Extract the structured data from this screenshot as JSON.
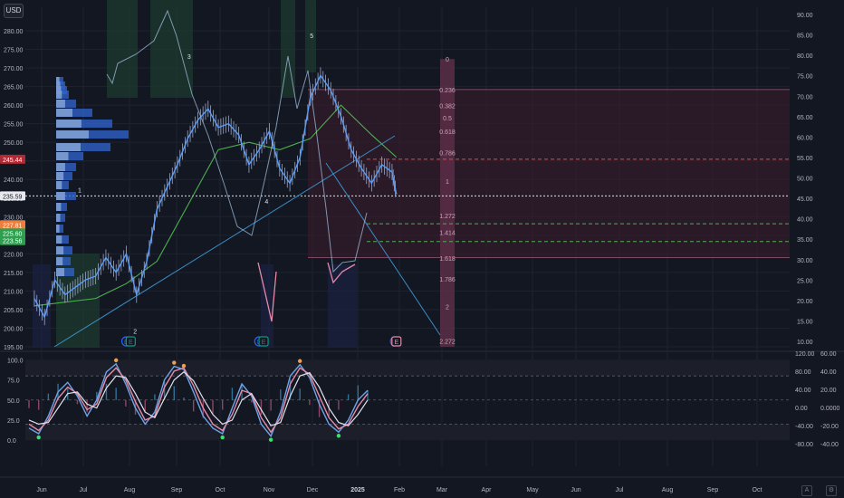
{
  "header": {
    "currency": "USD"
  },
  "colors": {
    "background": "#131722",
    "grid": "#1f2330",
    "price_main": "#5b9cf6",
    "price_alt": "#b5c3e8",
    "ma": "#4caf50",
    "fib_zone": "#3a1d2c",
    "support": "#4caf50",
    "resistance": "#e04a4a",
    "osc_blue": "#6ca4e8",
    "osc_pink": "#e68aa8",
    "osc_white": "#e0e3eb",
    "dot_green": "#39e06d",
    "dot_orange": "#f0a04b"
  },
  "chart_data": [
    {
      "type": "line",
      "panel": "price",
      "x_axis_labels": [
        "Jun",
        "Jul",
        "Aug",
        "Sep",
        "Oct",
        "Nov",
        "Dec",
        "2025",
        "Feb",
        "Mar",
        "Apr",
        "May",
        "Jun",
        "Jul",
        "Aug",
        "Sep",
        "Oct"
      ],
      "left_ticks": [
        "280.00",
        "275.00",
        "270.00",
        "265.00",
        "260.00",
        "255.00",
        "250.00",
        "245.00",
        "240.00",
        "235.00",
        "230.00",
        "225.00",
        "220.00",
        "215.00",
        "210.00",
        "205.00",
        "200.00",
        "195.00"
      ],
      "right_ticks": [
        "90.00",
        "85.00",
        "80.00",
        "75.00",
        "70.00",
        "65.00",
        "60.00",
        "55.00",
        "50.00",
        "45.00",
        "40.00",
        "35.00",
        "30.00",
        "25.00",
        "20.00",
        "15.00",
        "10.00"
      ],
      "ylim_left": [
        195,
        280
      ],
      "price_labels": [
        {
          "text": "245.44",
          "value": 245.44,
          "color": "#b22833"
        },
        {
          "text": "235.59",
          "value": 235.59,
          "color": "#e7e9ef"
        },
        {
          "text": "227.81",
          "value": 227.81,
          "color": "#f07d3a"
        },
        {
          "text": "225.60",
          "value": 225.6,
          "color": "#2e9e4f"
        },
        {
          "text": "223.56",
          "value": 223.56,
          "color": "#2e9e4f"
        }
      ],
      "current_price": 235.59,
      "wave_labels": [
        {
          "text": "1",
          "x": "2024-06-27",
          "price": 236.5
        },
        {
          "text": "2",
          "x": "2024-08-04",
          "price": 198.5
        },
        {
          "text": "3",
          "x": "2024-09-10",
          "price": 272.5
        },
        {
          "text": "4",
          "x": "2024-11-02",
          "price": 233.5
        },
        {
          "text": "5",
          "x": "2024-12-03",
          "price": 278.0
        }
      ],
      "fib_levels": [
        {
          "label": "0",
          "price": 272.4
        },
        {
          "label": "0.236",
          "price": 264.2
        },
        {
          "label": "0.382",
          "price": 259.9
        },
        {
          "label": "0.5",
          "price": 256.6
        },
        {
          "label": "0.618",
          "price": 253.0
        },
        {
          "label": "0.786",
          "price": 247.2
        },
        {
          "label": "1",
          "price": 239.6
        },
        {
          "label": "1.272",
          "price": 230.3
        },
        {
          "label": "1.414",
          "price": 225.8
        },
        {
          "label": "1.618",
          "price": 218.9
        },
        {
          "label": "1.786",
          "price": 213.3
        },
        {
          "label": "2",
          "price": 205.8
        },
        {
          "label": "2.272",
          "price": 196.6
        }
      ],
      "event_markers": [
        {
          "label": "D",
          "x": "2024-07-29",
          "color": "#2962ff"
        },
        {
          "label": "E",
          "x": "2024-08-01",
          "color": "#089981"
        },
        {
          "label": "D",
          "x": "2024-10-28",
          "color": "#2962ff"
        },
        {
          "label": "E",
          "x": "2024-10-31",
          "color": "#089981"
        },
        {
          "label": "D",
          "x": "2025-01-29",
          "color": "#2962ff"
        },
        {
          "label": "E",
          "x": "2025-01-30",
          "color": "#e68aa8"
        }
      ],
      "series": [
        {
          "name": "",
          "points": [
            [
              "2024-05-27",
              208
            ],
            [
              "2024-06-03",
              203
            ],
            [
              "2024-06-10",
              213
            ],
            [
              "2024-06-17",
              209
            ],
            [
              "2024-06-24",
              211
            ],
            [
              "2024-07-01",
              213
            ],
            [
              "2024-07-08",
              214
            ],
            [
              "2024-07-15",
              219
            ],
            [
              "2024-07-22",
              215
            ],
            [
              "2024-07-29",
              220
            ],
            [
              "2024-08-05",
              209
            ],
            [
              "2024-08-12",
              218
            ],
            [
              "2024-08-19",
              232
            ],
            [
              "2024-08-26",
              238
            ],
            [
              "2024-09-02",
              244
            ],
            [
              "2024-09-09",
              251
            ],
            [
              "2024-09-16",
              256
            ],
            [
              "2024-09-23",
              259
            ],
            [
              "2024-09-30",
              254
            ],
            [
              "2024-10-07",
              255
            ],
            [
              "2024-10-14",
              252
            ],
            [
              "2024-10-21",
              244
            ],
            [
              "2024-10-28",
              248
            ],
            [
              "2024-11-04",
              253
            ],
            [
              "2024-11-11",
              243
            ],
            [
              "2024-11-18",
              239
            ],
            [
              "2024-11-25",
              246
            ],
            [
              "2024-12-02",
              262
            ],
            [
              "2024-12-09",
              268
            ],
            [
              "2024-12-16",
              264
            ],
            [
              "2024-12-23",
              257
            ],
            [
              "2024-12-30",
              248
            ],
            [
              "2025-01-06",
              243
            ],
            [
              "2025-01-13",
              239
            ],
            [
              "2025-01-20",
              244
            ],
            [
              "2025-01-27",
              242
            ],
            [
              "2025-01-30",
              236
            ]
          ]
        }
      ],
      "ma": [
        [
          "2024-05-27",
          206
        ],
        [
          "2024-06-17",
          207
        ],
        [
          "2024-07-08",
          208
        ],
        [
          "2024-07-29",
          212
        ],
        [
          "2024-08-19",
          218
        ],
        [
          "2024-09-09",
          233
        ],
        [
          "2024-09-30",
          248
        ],
        [
          "2024-10-21",
          250
        ],
        [
          "2024-11-11",
          248
        ],
        [
          "2024-12-02",
          251
        ],
        [
          "2024-12-23",
          260
        ],
        [
          "2025-01-13",
          252
        ],
        [
          "2025-01-30",
          246
        ]
      ]
    },
    {
      "type": "line",
      "panel": "oscillator",
      "left_ticks": [
        "100.0",
        "75.0",
        "50.0",
        "25.0",
        "0.0"
      ],
      "right_ticks_a": [
        "120.00",
        "80.00",
        "40.00",
        "0.00",
        "-40.00",
        "-80.00"
      ],
      "right_ticks_b": [
        "60.00",
        "40.00",
        "20.00",
        "0.0000",
        "-20.00",
        "-40.00"
      ],
      "ylim": [
        -10,
        105
      ],
      "bands": [
        20,
        80
      ],
      "series": [
        {
          "name": "",
          "values": [
            15,
            8,
            30,
            60,
            72,
            55,
            30,
            50,
            85,
            95,
            70,
            40,
            20,
            35,
            75,
            92,
            88,
            60,
            30,
            15,
            8,
            40,
            70,
            55,
            20,
            5,
            35,
            80,
            94,
            78,
            45,
            20,
            10,
            25,
            50,
            62
          ]
        },
        {
          "name": "",
          "values": [
            20,
            12,
            25,
            52,
            66,
            58,
            38,
            45,
            78,
            90,
            75,
            48,
            25,
            30,
            66,
            86,
            90,
            68,
            40,
            20,
            12,
            32,
            62,
            58,
            28,
            10,
            28,
            70,
            90,
            82,
            55,
            28,
            14,
            20,
            42,
            58
          ]
        },
        {
          "name": "",
          "values": [
            25,
            20,
            22,
            40,
            58,
            60,
            45,
            40,
            65,
            80,
            78,
            58,
            35,
            28,
            52,
            75,
            85,
            74,
            52,
            32,
            20,
            25,
            50,
            58,
            38,
            18,
            22,
            55,
            80,
            84,
            66,
            40,
            22,
            18,
            32,
            50
          ]
        }
      ]
    }
  ]
}
